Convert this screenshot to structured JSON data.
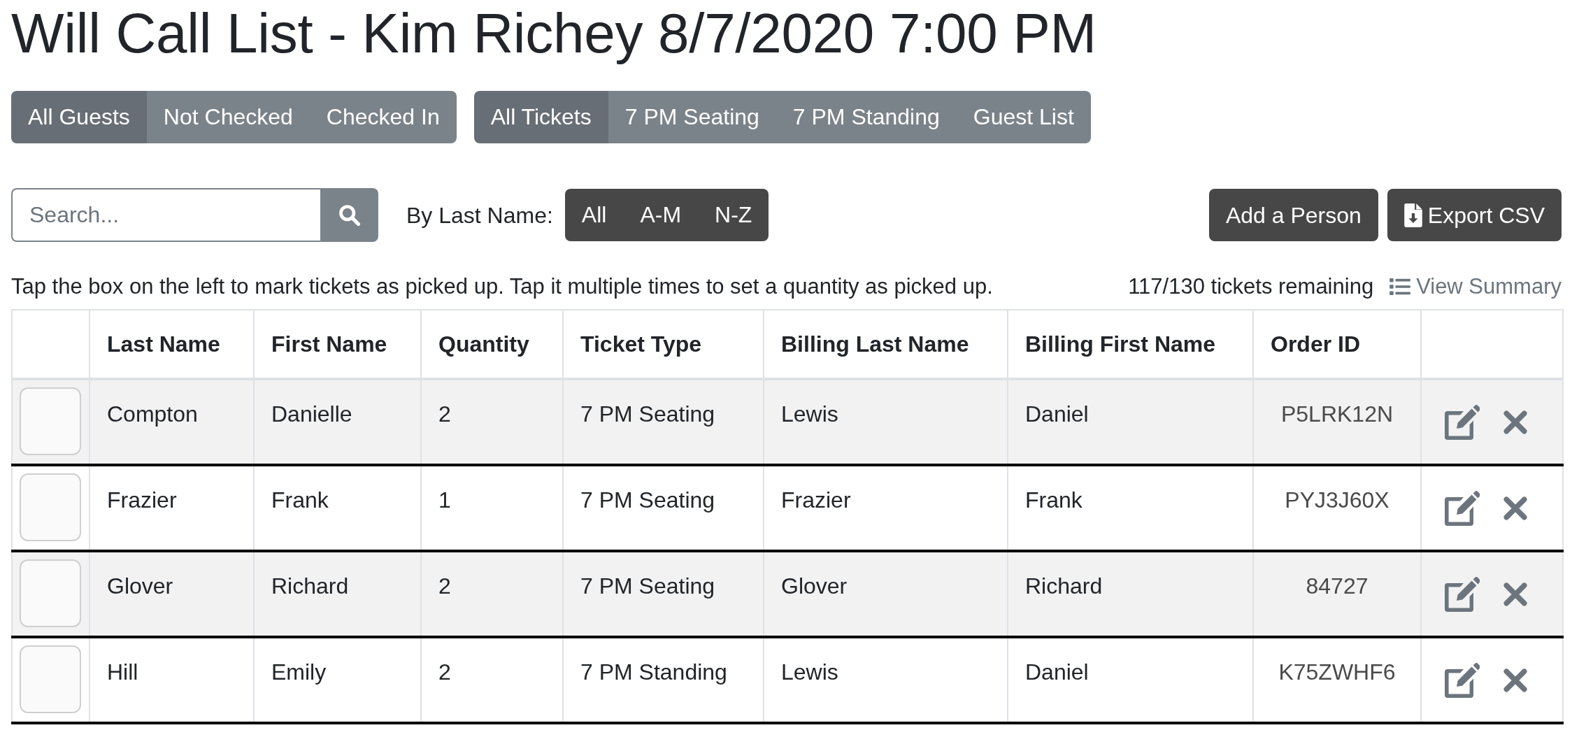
{
  "page": {
    "title": "Will Call List - Kim Richey 8/7/2020 7:00 PM"
  },
  "guest_filter": [
    {
      "label": "All Guests",
      "selected": true
    },
    {
      "label": "Not Checked",
      "selected": false
    },
    {
      "label": "Checked In",
      "selected": false
    }
  ],
  "ticket_filter": [
    {
      "label": "All Tickets",
      "selected": true
    },
    {
      "label": "7 PM Seating",
      "selected": false
    },
    {
      "label": "7 PM Standing",
      "selected": false
    },
    {
      "label": "Guest List",
      "selected": false
    }
  ],
  "search": {
    "placeholder": "Search..."
  },
  "last_name_filter": {
    "label": "By Last Name:",
    "options": [
      {
        "label": "All",
        "selected": false
      },
      {
        "label": "A-M",
        "selected": false
      },
      {
        "label": "N-Z",
        "selected": false
      }
    ]
  },
  "actions": [
    {
      "kind": "add",
      "label": "Add a Person"
    },
    {
      "kind": "export",
      "label": "Export CSV"
    }
  ],
  "instructions": "Tap the box on the left to mark tickets as picked up. Tap it multiple times to set a quantity as picked up.",
  "tickets_remaining": "117/130 tickets remaining",
  "view_summary": {
    "label": "View Summary"
  },
  "table": {
    "columns": [
      "Last Name",
      "First Name",
      "Quantity",
      "Ticket Type",
      "Billing Last Name",
      "Billing First Name",
      "Order ID"
    ],
    "rows": [
      {
        "checked": false,
        "cells": [
          "Compton",
          "Danielle",
          "2",
          "7 PM Seating",
          "Lewis",
          "Daniel",
          "P5LRK12N"
        ]
      },
      {
        "checked": false,
        "cells": [
          "Frazier",
          "Frank",
          "1",
          "7 PM Seating",
          "Frazier",
          "Frank",
          "PYJ3J60X"
        ]
      },
      {
        "checked": false,
        "cells": [
          "Glover",
          "Richard",
          "2",
          "7 PM Seating",
          "Glover",
          "Richard",
          "84727"
        ]
      },
      {
        "checked": false,
        "cells": [
          "Hill",
          "Emily",
          "2",
          "7 PM Standing",
          "Lewis",
          "Daniel",
          "K75ZWHF6"
        ]
      }
    ]
  }
}
